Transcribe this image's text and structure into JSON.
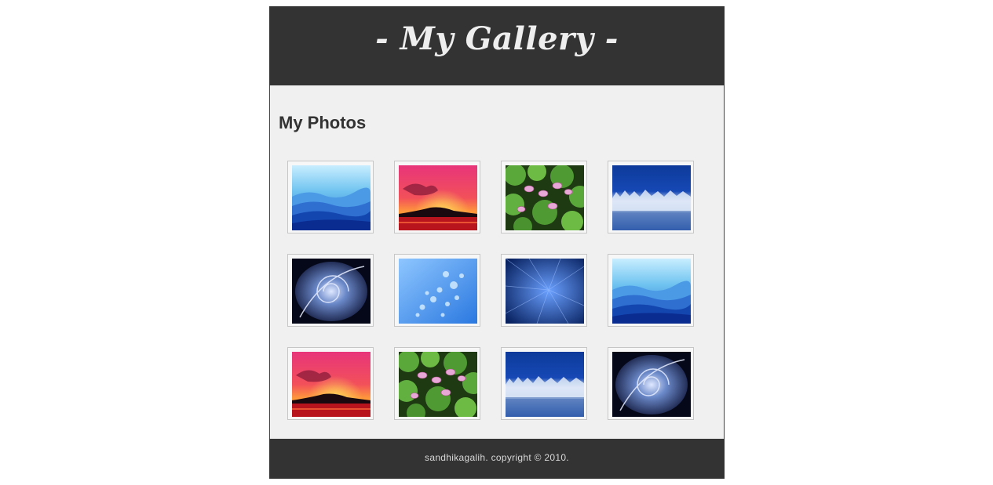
{
  "header": {
    "title": "- My Gallery -"
  },
  "main": {
    "heading": "My Photos",
    "photos": [
      {
        "name": "blue-mountains"
      },
      {
        "name": "red-sunset"
      },
      {
        "name": "lotus-flowers"
      },
      {
        "name": "frosted-forest"
      },
      {
        "name": "abstract-swirl"
      },
      {
        "name": "water-bubbles"
      },
      {
        "name": "blue-rays"
      },
      {
        "name": "blue-mountains"
      },
      {
        "name": "red-sunset"
      },
      {
        "name": "lotus-flowers"
      },
      {
        "name": "frosted-forest"
      },
      {
        "name": "abstract-swirl"
      }
    ]
  },
  "footer": {
    "copyright": "sandhikagalih. copyright © 2010."
  },
  "colors": {
    "header_bg": "#333333",
    "content_bg": "#f0f0f0",
    "title_text": "#eeeeee"
  }
}
